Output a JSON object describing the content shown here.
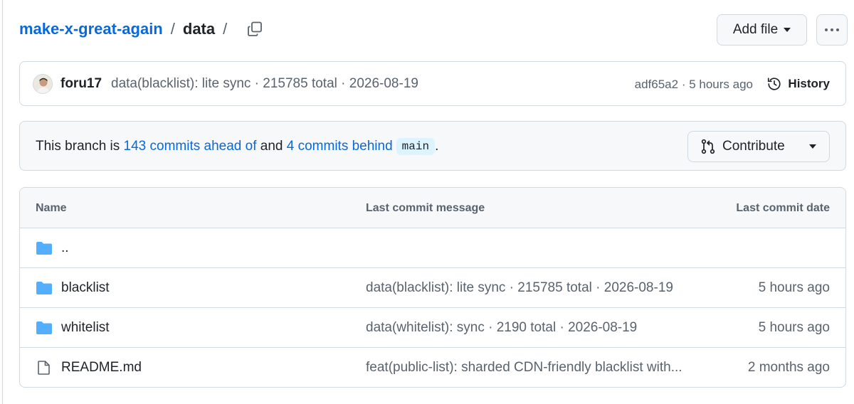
{
  "breadcrumb": {
    "repo": "make-x-great-again",
    "separator": "/",
    "current": "data",
    "trailing_separator": "/"
  },
  "header": {
    "add_file_label": "Add file",
    "more_icon": "kebab-horizontal-icon"
  },
  "commit": {
    "author": "foru17",
    "message": "data(blacklist): lite sync · 215785 total · 2026-08-19",
    "hash_and_time": "adf65a2 · 5 hours ago",
    "history_label": "History"
  },
  "branch": {
    "text_start": "This branch is ",
    "ahead_link": "143 commits ahead of",
    "text_and": " and ",
    "behind_link": "4 commits behind",
    "base_branch": "main",
    "text_end": ".",
    "contribute_label": "Contribute"
  },
  "table": {
    "headers": {
      "name": "Name",
      "message": "Last commit message",
      "date": "Last commit date"
    },
    "rows": [
      {
        "type": "folder",
        "name": "..",
        "message": "",
        "date": ""
      },
      {
        "type": "folder",
        "name": "blacklist",
        "message": "data(blacklist): lite sync · 215785 total · 2026-08-19",
        "date": "5 hours ago"
      },
      {
        "type": "folder",
        "name": "whitelist",
        "message": "data(whitelist): sync · 2190 total · 2026-08-19",
        "date": "5 hours ago"
      },
      {
        "type": "file",
        "name": "README.md",
        "message": "feat(public-list): sharded CDN-friendly blacklist with...",
        "date": "2 months ago"
      }
    ]
  },
  "colors": {
    "link": "#0969da",
    "text": "#1f2328",
    "muted": "#59636e",
    "border": "#d1d9e0",
    "folder": "#54aeff",
    "subtle_bg": "#f6f8fa"
  }
}
